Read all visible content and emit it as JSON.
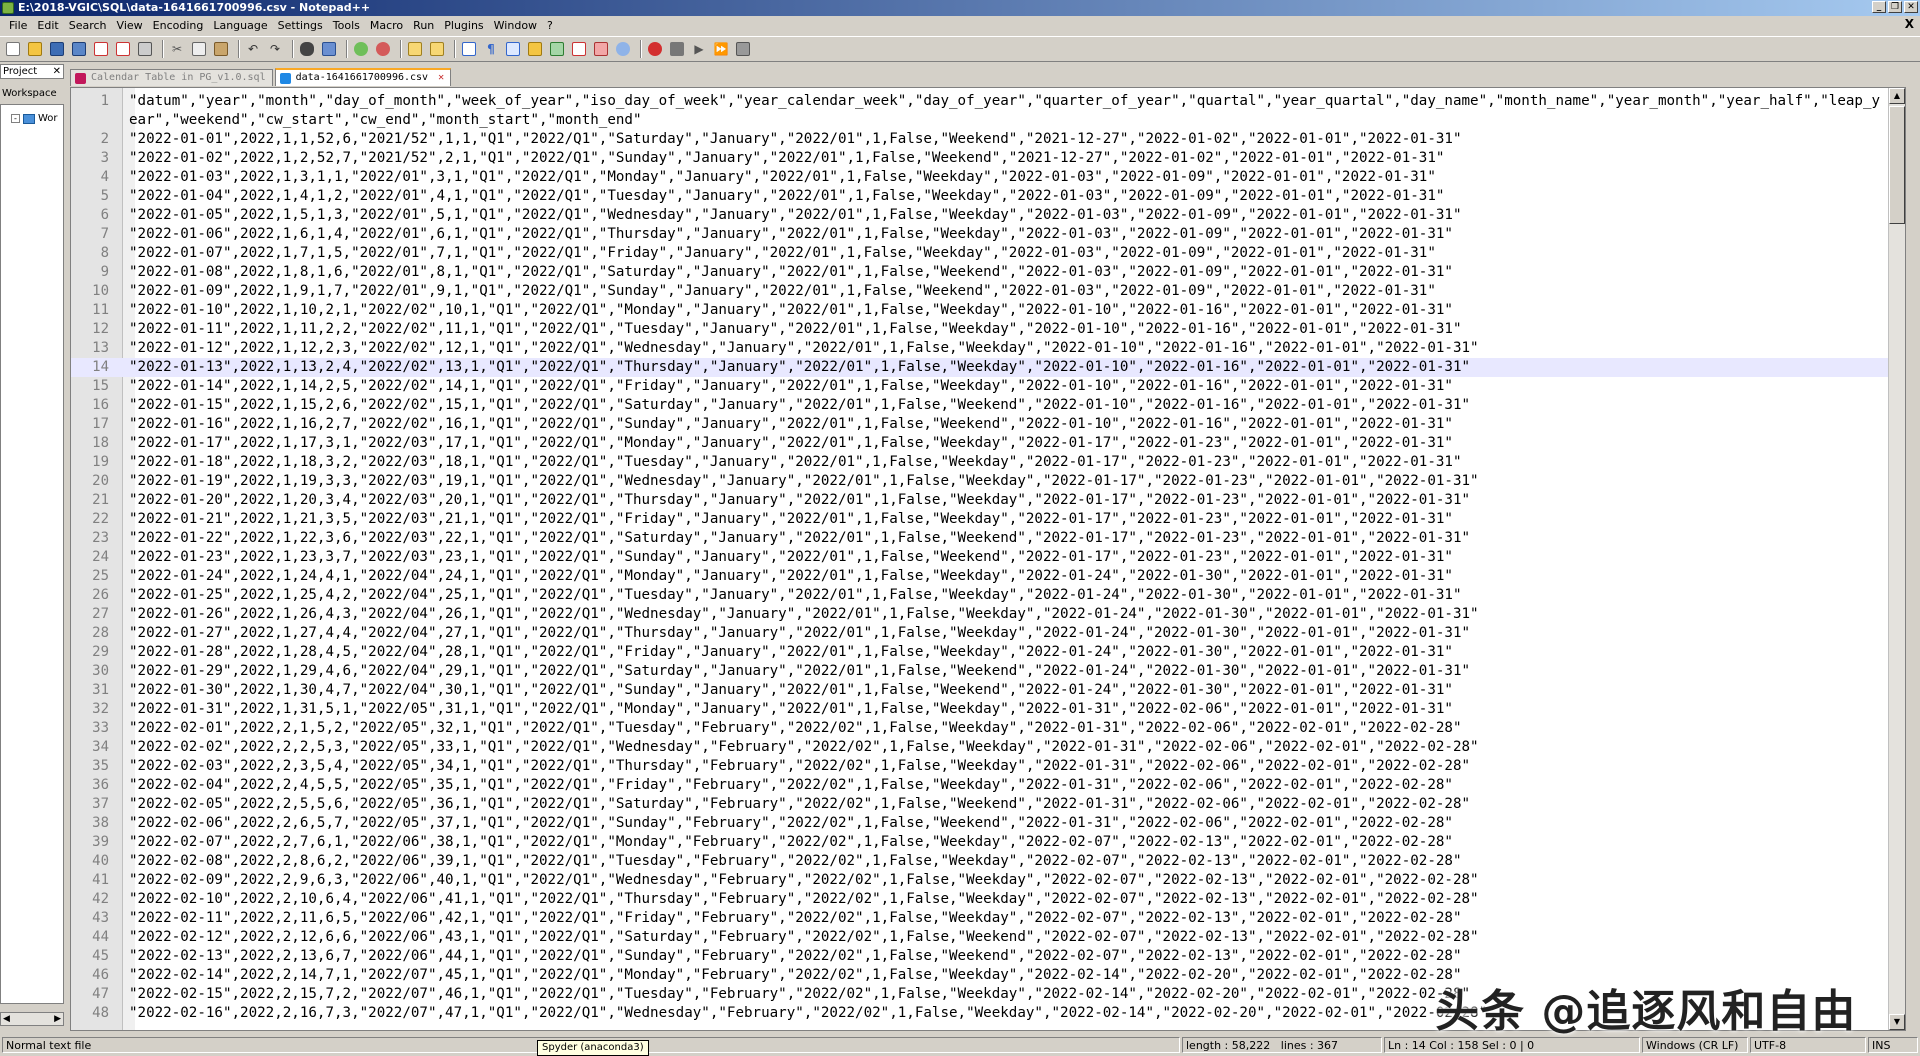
{
  "window": {
    "title": "E:\\2018-VGIC\\SQL\\data-1641661700996.csv - Notepad++"
  },
  "menu": [
    "File",
    "Edit",
    "Search",
    "View",
    "Encoding",
    "Language",
    "Settings",
    "Tools",
    "Macro",
    "Run",
    "Plugins",
    "Window",
    "?"
  ],
  "menu_close": "X",
  "project_panel": {
    "tab_label": "Project",
    "workspace_label": "Workspace",
    "tree_item": "Wor"
  },
  "tabs": [
    {
      "label": "Calendar Table in PG_v1.0.sql"
    },
    {
      "label": "data-1641661700996.csv"
    }
  ],
  "editor": {
    "lines": [
      "\"datum\",\"year\",\"month\",\"day_of_month\",\"week_of_year\",\"iso_day_of_week\",\"year_calendar_week\",\"day_of_year\",\"quarter_of_year\",\"quartal\",\"year_quartal\",\"day_name\",\"month_name\",\"year_month\",\"year_half\",\"leap_year\",\"weekend\",\"cw_start\",\"cw_end\",\"month_start\",\"month_end\"",
      "\"2022-01-01\",2022,1,1,52,6,\"2021/52\",1,1,\"Q1\",\"2022/Q1\",\"Saturday\",\"January\",\"2022/01\",1,False,\"Weekend\",\"2021-12-27\",\"2022-01-02\",\"2022-01-01\",\"2022-01-31\"",
      "\"2022-01-02\",2022,1,2,52,7,\"2021/52\",2,1,\"Q1\",\"2022/Q1\",\"Sunday\",\"January\",\"2022/01\",1,False,\"Weekend\",\"2021-12-27\",\"2022-01-02\",\"2022-01-01\",\"2022-01-31\"",
      "\"2022-01-03\",2022,1,3,1,1,\"2022/01\",3,1,\"Q1\",\"2022/Q1\",\"Monday\",\"January\",\"2022/01\",1,False,\"Weekday\",\"2022-01-03\",\"2022-01-09\",\"2022-01-01\",\"2022-01-31\"",
      "\"2022-01-04\",2022,1,4,1,2,\"2022/01\",4,1,\"Q1\",\"2022/Q1\",\"Tuesday\",\"January\",\"2022/01\",1,False,\"Weekday\",\"2022-01-03\",\"2022-01-09\",\"2022-01-01\",\"2022-01-31\"",
      "\"2022-01-05\",2022,1,5,1,3,\"2022/01\",5,1,\"Q1\",\"2022/Q1\",\"Wednesday\",\"January\",\"2022/01\",1,False,\"Weekday\",\"2022-01-03\",\"2022-01-09\",\"2022-01-01\",\"2022-01-31\"",
      "\"2022-01-06\",2022,1,6,1,4,\"2022/01\",6,1,\"Q1\",\"2022/Q1\",\"Thursday\",\"January\",\"2022/01\",1,False,\"Weekday\",\"2022-01-03\",\"2022-01-09\",\"2022-01-01\",\"2022-01-31\"",
      "\"2022-01-07\",2022,1,7,1,5,\"2022/01\",7,1,\"Q1\",\"2022/Q1\",\"Friday\",\"January\",\"2022/01\",1,False,\"Weekday\",\"2022-01-03\",\"2022-01-09\",\"2022-01-01\",\"2022-01-31\"",
      "\"2022-01-08\",2022,1,8,1,6,\"2022/01\",8,1,\"Q1\",\"2022/Q1\",\"Saturday\",\"January\",\"2022/01\",1,False,\"Weekend\",\"2022-01-03\",\"2022-01-09\",\"2022-01-01\",\"2022-01-31\"",
      "\"2022-01-09\",2022,1,9,1,7,\"2022/01\",9,1,\"Q1\",\"2022/Q1\",\"Sunday\",\"January\",\"2022/01\",1,False,\"Weekend\",\"2022-01-03\",\"2022-01-09\",\"2022-01-01\",\"2022-01-31\"",
      "\"2022-01-10\",2022,1,10,2,1,\"2022/02\",10,1,\"Q1\",\"2022/Q1\",\"Monday\",\"January\",\"2022/01\",1,False,\"Weekday\",\"2022-01-10\",\"2022-01-16\",\"2022-01-01\",\"2022-01-31\"",
      "\"2022-01-11\",2022,1,11,2,2,\"2022/02\",11,1,\"Q1\",\"2022/Q1\",\"Tuesday\",\"January\",\"2022/01\",1,False,\"Weekday\",\"2022-01-10\",\"2022-01-16\",\"2022-01-01\",\"2022-01-31\"",
      "\"2022-01-12\",2022,1,12,2,3,\"2022/02\",12,1,\"Q1\",\"2022/Q1\",\"Wednesday\",\"January\",\"2022/01\",1,False,\"Weekday\",\"2022-01-10\",\"2022-01-16\",\"2022-01-01\",\"2022-01-31\"",
      "\"2022-01-13\",2022,1,13,2,4,\"2022/02\",13,1,\"Q1\",\"2022/Q1\",\"Thursday\",\"January\",\"2022/01\",1,False,\"Weekday\",\"2022-01-10\",\"2022-01-16\",\"2022-01-01\",\"2022-01-31\"",
      "\"2022-01-14\",2022,1,14,2,5,\"2022/02\",14,1,\"Q1\",\"2022/Q1\",\"Friday\",\"January\",\"2022/01\",1,False,\"Weekday\",\"2022-01-10\",\"2022-01-16\",\"2022-01-01\",\"2022-01-31\"",
      "\"2022-01-15\",2022,1,15,2,6,\"2022/02\",15,1,\"Q1\",\"2022/Q1\",\"Saturday\",\"January\",\"2022/01\",1,False,\"Weekend\",\"2022-01-10\",\"2022-01-16\",\"2022-01-01\",\"2022-01-31\"",
      "\"2022-01-16\",2022,1,16,2,7,\"2022/02\",16,1,\"Q1\",\"2022/Q1\",\"Sunday\",\"January\",\"2022/01\",1,False,\"Weekend\",\"2022-01-10\",\"2022-01-16\",\"2022-01-01\",\"2022-01-31\"",
      "\"2022-01-17\",2022,1,17,3,1,\"2022/03\",17,1,\"Q1\",\"2022/Q1\",\"Monday\",\"January\",\"2022/01\",1,False,\"Weekday\",\"2022-01-17\",\"2022-01-23\",\"2022-01-01\",\"2022-01-31\"",
      "\"2022-01-18\",2022,1,18,3,2,\"2022/03\",18,1,\"Q1\",\"2022/Q1\",\"Tuesday\",\"January\",\"2022/01\",1,False,\"Weekday\",\"2022-01-17\",\"2022-01-23\",\"2022-01-01\",\"2022-01-31\"",
      "\"2022-01-19\",2022,1,19,3,3,\"2022/03\",19,1,\"Q1\",\"2022/Q1\",\"Wednesday\",\"January\",\"2022/01\",1,False,\"Weekday\",\"2022-01-17\",\"2022-01-23\",\"2022-01-01\",\"2022-01-31\"",
      "\"2022-01-20\",2022,1,20,3,4,\"2022/03\",20,1,\"Q1\",\"2022/Q1\",\"Thursday\",\"January\",\"2022/01\",1,False,\"Weekday\",\"2022-01-17\",\"2022-01-23\",\"2022-01-01\",\"2022-01-31\"",
      "\"2022-01-21\",2022,1,21,3,5,\"2022/03\",21,1,\"Q1\",\"2022/Q1\",\"Friday\",\"January\",\"2022/01\",1,False,\"Weekday\",\"2022-01-17\",\"2022-01-23\",\"2022-01-01\",\"2022-01-31\"",
      "\"2022-01-22\",2022,1,22,3,6,\"2022/03\",22,1,\"Q1\",\"2022/Q1\",\"Saturday\",\"January\",\"2022/01\",1,False,\"Weekend\",\"2022-01-17\",\"2022-01-23\",\"2022-01-01\",\"2022-01-31\"",
      "\"2022-01-23\",2022,1,23,3,7,\"2022/03\",23,1,\"Q1\",\"2022/Q1\",\"Sunday\",\"January\",\"2022/01\",1,False,\"Weekend\",\"2022-01-17\",\"2022-01-23\",\"2022-01-01\",\"2022-01-31\"",
      "\"2022-01-24\",2022,1,24,4,1,\"2022/04\",24,1,\"Q1\",\"2022/Q1\",\"Monday\",\"January\",\"2022/01\",1,False,\"Weekday\",\"2022-01-24\",\"2022-01-30\",\"2022-01-01\",\"2022-01-31\"",
      "\"2022-01-25\",2022,1,25,4,2,\"2022/04\",25,1,\"Q1\",\"2022/Q1\",\"Tuesday\",\"January\",\"2022/01\",1,False,\"Weekday\",\"2022-01-24\",\"2022-01-30\",\"2022-01-01\",\"2022-01-31\"",
      "\"2022-01-26\",2022,1,26,4,3,\"2022/04\",26,1,\"Q1\",\"2022/Q1\",\"Wednesday\",\"January\",\"2022/01\",1,False,\"Weekday\",\"2022-01-24\",\"2022-01-30\",\"2022-01-01\",\"2022-01-31\"",
      "\"2022-01-27\",2022,1,27,4,4,\"2022/04\",27,1,\"Q1\",\"2022/Q1\",\"Thursday\",\"January\",\"2022/01\",1,False,\"Weekday\",\"2022-01-24\",\"2022-01-30\",\"2022-01-01\",\"2022-01-31\"",
      "\"2022-01-28\",2022,1,28,4,5,\"2022/04\",28,1,\"Q1\",\"2022/Q1\",\"Friday\",\"January\",\"2022/01\",1,False,\"Weekday\",\"2022-01-24\",\"2022-01-30\",\"2022-01-01\",\"2022-01-31\"",
      "\"2022-01-29\",2022,1,29,4,6,\"2022/04\",29,1,\"Q1\",\"2022/Q1\",\"Saturday\",\"January\",\"2022/01\",1,False,\"Weekend\",\"2022-01-24\",\"2022-01-30\",\"2022-01-01\",\"2022-01-31\"",
      "\"2022-01-30\",2022,1,30,4,7,\"2022/04\",30,1,\"Q1\",\"2022/Q1\",\"Sunday\",\"January\",\"2022/01\",1,False,\"Weekend\",\"2022-01-24\",\"2022-01-30\",\"2022-01-01\",\"2022-01-31\"",
      "\"2022-01-31\",2022,1,31,5,1,\"2022/05\",31,1,\"Q1\",\"2022/Q1\",\"Monday\",\"January\",\"2022/01\",1,False,\"Weekday\",\"2022-01-31\",\"2022-02-06\",\"2022-01-01\",\"2022-01-31\"",
      "\"2022-02-01\",2022,2,1,5,2,\"2022/05\",32,1,\"Q1\",\"2022/Q1\",\"Tuesday\",\"February\",\"2022/02\",1,False,\"Weekday\",\"2022-01-31\",\"2022-02-06\",\"2022-02-01\",\"2022-02-28\"",
      "\"2022-02-02\",2022,2,2,5,3,\"2022/05\",33,1,\"Q1\",\"2022/Q1\",\"Wednesday\",\"February\",\"2022/02\",1,False,\"Weekday\",\"2022-01-31\",\"2022-02-06\",\"2022-02-01\",\"2022-02-28\"",
      "\"2022-02-03\",2022,2,3,5,4,\"2022/05\",34,1,\"Q1\",\"2022/Q1\",\"Thursday\",\"February\",\"2022/02\",1,False,\"Weekday\",\"2022-01-31\",\"2022-02-06\",\"2022-02-01\",\"2022-02-28\"",
      "\"2022-02-04\",2022,2,4,5,5,\"2022/05\",35,1,\"Q1\",\"2022/Q1\",\"Friday\",\"February\",\"2022/02\",1,False,\"Weekday\",\"2022-01-31\",\"2022-02-06\",\"2022-02-01\",\"2022-02-28\"",
      "\"2022-02-05\",2022,2,5,5,6,\"2022/05\",36,1,\"Q1\",\"2022/Q1\",\"Saturday\",\"February\",\"2022/02\",1,False,\"Weekend\",\"2022-01-31\",\"2022-02-06\",\"2022-02-01\",\"2022-02-28\"",
      "\"2022-02-06\",2022,2,6,5,7,\"2022/05\",37,1,\"Q1\",\"2022/Q1\",\"Sunday\",\"February\",\"2022/02\",1,False,\"Weekend\",\"2022-01-31\",\"2022-02-06\",\"2022-02-01\",\"2022-02-28\"",
      "\"2022-02-07\",2022,2,7,6,1,\"2022/06\",38,1,\"Q1\",\"2022/Q1\",\"Monday\",\"February\",\"2022/02\",1,False,\"Weekday\",\"2022-02-07\",\"2022-02-13\",\"2022-02-01\",\"2022-02-28\"",
      "\"2022-02-08\",2022,2,8,6,2,\"2022/06\",39,1,\"Q1\",\"2022/Q1\",\"Tuesday\",\"February\",\"2022/02\",1,False,\"Weekday\",\"2022-02-07\",\"2022-02-13\",\"2022-02-01\",\"2022-02-28\"",
      "\"2022-02-09\",2022,2,9,6,3,\"2022/06\",40,1,\"Q1\",\"2022/Q1\",\"Wednesday\",\"February\",\"2022/02\",1,False,\"Weekday\",\"2022-02-07\",\"2022-02-13\",\"2022-02-01\",\"2022-02-28\"",
      "\"2022-02-10\",2022,2,10,6,4,\"2022/06\",41,1,\"Q1\",\"2022/Q1\",\"Thursday\",\"February\",\"2022/02\",1,False,\"Weekday\",\"2022-02-07\",\"2022-02-13\",\"2022-02-01\",\"2022-02-28\"",
      "\"2022-02-11\",2022,2,11,6,5,\"2022/06\",42,1,\"Q1\",\"2022/Q1\",\"Friday\",\"February\",\"2022/02\",1,False,\"Weekday\",\"2022-02-07\",\"2022-02-13\",\"2022-02-01\",\"2022-02-28\"",
      "\"2022-02-12\",2022,2,12,6,6,\"2022/06\",43,1,\"Q1\",\"2022/Q1\",\"Saturday\",\"February\",\"2022/02\",1,False,\"Weekend\",\"2022-02-07\",\"2022-02-13\",\"2022-02-01\",\"2022-02-28\"",
      "\"2022-02-13\",2022,2,13,6,7,\"2022/06\",44,1,\"Q1\",\"2022/Q1\",\"Sunday\",\"February\",\"2022/02\",1,False,\"Weekend\",\"2022-02-07\",\"2022-02-13\",\"2022-02-01\",\"2022-02-28\"",
      "\"2022-02-14\",2022,2,14,7,1,\"2022/07\",45,1,\"Q1\",\"2022/Q1\",\"Monday\",\"February\",\"2022/02\",1,False,\"Weekday\",\"2022-02-14\",\"2022-02-20\",\"2022-02-01\",\"2022-02-28\"",
      "\"2022-02-15\",2022,2,15,7,2,\"2022/07\",46,1,\"Q1\",\"2022/Q1\",\"Tuesday\",\"February\",\"2022/02\",1,False,\"Weekday\",\"2022-02-14\",\"2022-02-20\",\"2022-02-01\",\"2022-02-28\"",
      "\"2022-02-16\",2022,2,16,7,3,\"2022/07\",47,1,\"Q1\",\"2022/Q1\",\"Wednesday\",\"February\",\"2022/02\",1,False,\"Weekday\",\"2022-02-14\",\"2022-02-20\",\"2022-02-01\",\"2022-02-28\""
    ],
    "current_line": 14
  },
  "watermark": "头条 @追逐风和自由",
  "status": {
    "file_type": "Normal text file",
    "length": "length : 58,222",
    "lines": "lines : 367",
    "position": "Ln : 14    Col : 158    Sel : 0 | 0",
    "eol": "Windows (CR LF)",
    "encoding": "UTF-8",
    "mode": "INS"
  },
  "tooltip": "Spyder (anaconda3)"
}
